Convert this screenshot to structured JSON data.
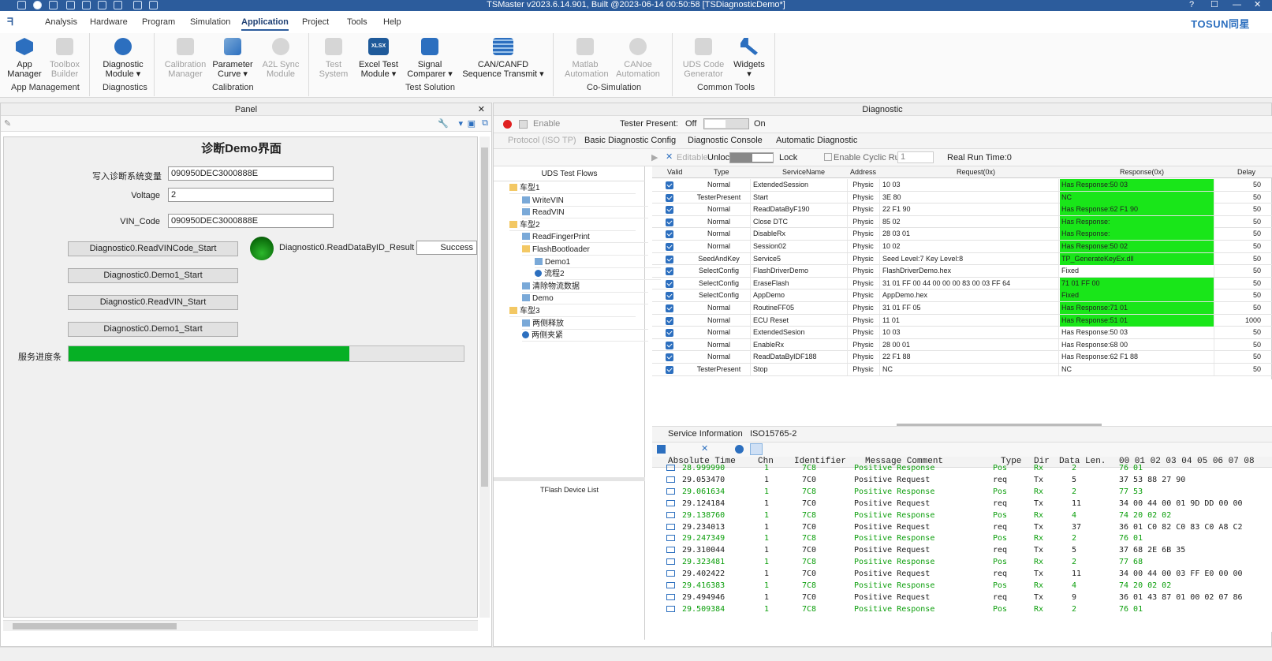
{
  "app_title": "TSMaster v2023.6.14.901, Built @2023-06-14 00:50:58 [TSDiagnosticDemo*]",
  "window_controls": {
    "help": "?",
    "minimize": "—",
    "maximize": "☐",
    "close": "✕"
  },
  "brand": "TOSUN同星",
  "menu": {
    "analysis": "Analysis",
    "hardware": "Hardware",
    "program": "Program",
    "simulation": "Simulation",
    "application": "Application",
    "project": "Project",
    "tools": "Tools",
    "help": "Help"
  },
  "ribbon": {
    "app_manager": "App\nManager",
    "toolbox_builder": "Toolbox\nBuilder",
    "diagnostic_module": "Diagnostic\nModule ▾",
    "calibration_manager": "Calibration\nManager",
    "parameter_curve": "Parameter\nCurve ▾",
    "a2l_sync_module": "A2L Sync\nModule",
    "test_system": "Test\nSystem",
    "excel_test_module": "Excel Test\nModule ▾",
    "signal_comparer": "Signal\nComparer ▾",
    "can_canfd_sequence": "CAN/CANFD\nSequence Transmit ▾",
    "matlab_automation": "Matlab\nAutomation",
    "canoe_automation": "CANoe\nAutomation",
    "uds_code_generator": "UDS Code\nGenerator",
    "widgets": "Widgets\n▾",
    "excel_badge": "XLSX",
    "groups": {
      "app_management": "App Management",
      "diagnostics": "Diagnostics",
      "calibration": "Calibration",
      "test_solution": "Test Solution",
      "co_simulation": "Co-Simulation",
      "common_tools": "Common Tools"
    }
  },
  "panel": {
    "title": "Panel",
    "heading": "诊断Demo界面",
    "fields": {
      "write_label": "写入诊断系统变量",
      "write_value": "090950DEC3000888E",
      "voltage_label": "Voltage",
      "voltage_value": "2",
      "vin_label": "VIN_Code",
      "vin_value": "090950DEC3000888E"
    },
    "buttons": {
      "readvincode": "Diagnostic0.ReadVINCode_Start",
      "demo1_a": "Diagnostic0.Demo1_Start",
      "readvin": "Diagnostic0.ReadVIN_Start",
      "demo1_b": "Diagnostic0.Demo1_Start"
    },
    "result_label": "Diagnostic0.ReadDataByID_Result",
    "result_value": "Success",
    "progress_label": "服务进度条",
    "progress_fraction": 0.71
  },
  "diagnostic": {
    "title": "Diagnostic",
    "enable": "Enable",
    "tester_present": "Tester Present:",
    "off": "Off",
    "on": "On",
    "tabs": {
      "protocol": "Protocol (ISO TP)",
      "basic": "Basic Diagnostic Config",
      "console": "Diagnostic Console",
      "auto": "Automatic Diagnostic"
    },
    "edit_bar": {
      "editable": "Editable",
      "unlock": "Unlock",
      "lock": "Lock",
      "cyclic": "Enable Cyclic Run",
      "cyclic_value": "1",
      "real_run": "Real Run Time:0"
    },
    "tree": {
      "header": "UDS Test Flows",
      "nodes": [
        "车型1",
        "WriteVIN",
        "ReadVIN",
        "车型2",
        "ReadFingerPrint",
        "FlashBootloader",
        "Demo1",
        "流程2",
        "清除物流数据",
        "Demo",
        "车型3",
        "两侧释放",
        "两侧夹紧"
      ],
      "flash_device_list": "TFlash Device List"
    },
    "grid": {
      "headers": {
        "valid": "Valid",
        "type": "Type",
        "service": "ServiceName",
        "address": "Address",
        "request": "Request(0x)",
        "response": "Response(0x)",
        "delay": "Delay"
      },
      "rows": [
        {
          "type": "Normal",
          "service": "ExtendedSession",
          "address": "Physic",
          "request": "10 03",
          "response": "Has Response:50 03",
          "delay": "50"
        },
        {
          "type": "TesterPresent",
          "service": "Start",
          "address": "Physic",
          "request": "3E 80",
          "response": "NC",
          "delay": "50"
        },
        {
          "type": "Normal",
          "service": "ReadDataByF190",
          "address": "Physic",
          "request": "22 F1 90",
          "response": "Has Response:62 F1 90",
          "delay": "50"
        },
        {
          "type": "Normal",
          "service": "Close DTC",
          "address": "Physic",
          "request": "85 02",
          "response": "Has Response:",
          "delay": "50"
        },
        {
          "type": "Normal",
          "service": "DisableRx",
          "address": "Physic",
          "request": "28 03 01",
          "response": "Has Response:",
          "delay": "50"
        },
        {
          "type": "Normal",
          "service": "Session02",
          "address": "Physic",
          "request": "10 02",
          "response": "Has Response:50 02",
          "delay": "50"
        },
        {
          "type": "SeedAndKey",
          "service": "Service5",
          "address": "Physic",
          "request": "Seed Level:7 Key Level:8",
          "response": "TP_GenerateKeyEx.dll",
          "delay": "50"
        },
        {
          "type": "SelectConfig",
          "service": "FlashDriverDemo",
          "address": "Physic",
          "request": "FlashDriverDemo.hex",
          "response": "Fixed",
          "delay": "50"
        },
        {
          "type": "SelectConfig",
          "service": "EraseFlash",
          "address": "Physic",
          "request": "31 01 FF 00 44 00 00 00 83 00 03 FF 64",
          "response": "71 01 FF 00",
          "delay": "50"
        },
        {
          "type": "SelectConfig",
          "service": "AppDemo",
          "address": "Physic",
          "request": "AppDemo.hex",
          "response": "Fixed",
          "delay": "50"
        },
        {
          "type": "Normal",
          "service": "RoutineFF05",
          "address": "Physic",
          "request": "31 01 FF 05",
          "response": "Has Response:71 01",
          "delay": "50"
        },
        {
          "type": "Normal",
          "service": "ECU Reset",
          "address": "Physic",
          "request": "11 01",
          "response": "Has Response:51 01",
          "delay": "1000"
        },
        {
          "type": "Normal",
          "service": "ExtendedSesion",
          "address": "Physic",
          "request": "10 03",
          "response": "Has Response:50 03",
          "delay": "50"
        },
        {
          "type": "Normal",
          "service": "EnableRx",
          "address": "Physic",
          "request": "28 00 01",
          "response": "Has Response:68 00",
          "delay": "50"
        },
        {
          "type": "Normal",
          "service": "ReadDataByIDF188",
          "address": "Physic",
          "request": "22 F1 88",
          "response": "Has Response:62 F1 88",
          "delay": "50"
        },
        {
          "type": "TesterPresent",
          "service": "Stop",
          "address": "Physic",
          "request": "NC",
          "response": "NC",
          "delay": "50"
        }
      ],
      "highlighted_rows": [
        0,
        1,
        2,
        3,
        4,
        5,
        6,
        8,
        9,
        10,
        11
      ]
    },
    "bottom_tabs": {
      "service_info": "Service Information",
      "iso": "ISO15765-2"
    },
    "trace": {
      "headers": {
        "time": "Absolute Time",
        "chn": "Chn",
        "id": "Identifier",
        "comment": "Message Comment",
        "type": "Type",
        "dir": "Dir",
        "len": "Data Len.",
        "data": "00 01 02 03 04 05 06 07 08"
      },
      "rows": [
        {
          "time": "28.999990",
          "chn": "1",
          "id": "7C8",
          "comment": "Positive Response",
          "type": "Pos",
          "dir": "Rx",
          "len": "2",
          "data": "76 01",
          "rx": true
        },
        {
          "time": "29.053470",
          "chn": "1",
          "id": "7C0",
          "comment": "Positive Request",
          "type": "req",
          "dir": "Tx",
          "len": "5",
          "data": "37 53 88 27 90",
          "rx": false
        },
        {
          "time": "29.061634",
          "chn": "1",
          "id": "7C8",
          "comment": "Positive Response",
          "type": "Pos",
          "dir": "Rx",
          "len": "2",
          "data": "77 53",
          "rx": true
        },
        {
          "time": "29.124184",
          "chn": "1",
          "id": "7C0",
          "comment": "Positive Request",
          "type": "req",
          "dir": "Tx",
          "len": "11",
          "data": "34 00 44 00 01 9D DD 00 00",
          "rx": false
        },
        {
          "time": "29.138760",
          "chn": "1",
          "id": "7C8",
          "comment": "Positive Response",
          "type": "Pos",
          "dir": "Rx",
          "len": "4",
          "data": "74 20 02 02",
          "rx": true
        },
        {
          "time": "29.234013",
          "chn": "1",
          "id": "7C0",
          "comment": "Positive Request",
          "type": "req",
          "dir": "Tx",
          "len": "37",
          "data": "36 01 C0 82 C0 83 C0 A8 C2",
          "rx": false
        },
        {
          "time": "29.247349",
          "chn": "1",
          "id": "7C8",
          "comment": "Positive Response",
          "type": "Pos",
          "dir": "Rx",
          "len": "2",
          "data": "76 01",
          "rx": true
        },
        {
          "time": "29.310044",
          "chn": "1",
          "id": "7C0",
          "comment": "Positive Request",
          "type": "req",
          "dir": "Tx",
          "len": "5",
          "data": "37 68 2E 6B 35",
          "rx": false
        },
        {
          "time": "29.323481",
          "chn": "1",
          "id": "7C8",
          "comment": "Positive Response",
          "type": "Pos",
          "dir": "Rx",
          "len": "2",
          "data": "77 68",
          "rx": true
        },
        {
          "time": "29.402422",
          "chn": "1",
          "id": "7C0",
          "comment": "Positive Request",
          "type": "req",
          "dir": "Tx",
          "len": "11",
          "data": "34 00 44 00 03 FF E0 00 00",
          "rx": false
        },
        {
          "time": "29.416383",
          "chn": "1",
          "id": "7C8",
          "comment": "Positive Response",
          "type": "Pos",
          "dir": "Rx",
          "len": "4",
          "data": "74 20 02 02",
          "rx": true
        },
        {
          "time": "29.494946",
          "chn": "1",
          "id": "7C0",
          "comment": "Positive Request",
          "type": "req",
          "dir": "Tx",
          "len": "9",
          "data": "36 01 43 87 01 00 02 07 86",
          "rx": false
        },
        {
          "time": "29.509384",
          "chn": "1",
          "id": "7C8",
          "comment": "Positive Response",
          "type": "Pos",
          "dir": "Rx",
          "len": "2",
          "data": "76 01",
          "rx": true
        }
      ]
    }
  }
}
